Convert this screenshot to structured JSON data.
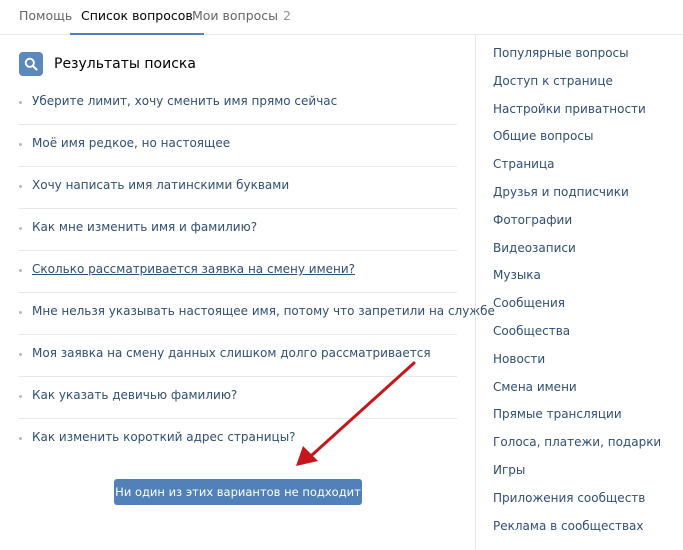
{
  "tabs": [
    {
      "label": "Помощь"
    },
    {
      "label": "Список вопросов"
    },
    {
      "label": "Мои вопросы",
      "count": "2"
    }
  ],
  "main": {
    "title": "Результаты поиска",
    "search_icon": "search-icon",
    "questions": [
      "Уберите лимит, хочу сменить имя прямо сейчас",
      "Моё имя редкое, но настоящее",
      "Хочу написать имя латинскими буквами",
      "Как мне изменить имя и фамилию?",
      "Сколько рассматривается заявка на смену имени?",
      "Мне нельзя указывать настоящее имя, потому что запретили на службе",
      "Моя заявка на смену данных слишком долго рассматривается",
      "Как указать девичью фамилию?",
      "Как изменить короткий адрес страницы?"
    ],
    "no_match_button": "Ни один из этих вариантов не подходит"
  },
  "sidebar": {
    "items": [
      "Популярные вопросы",
      "Доступ к странице",
      "Настройки приватности",
      "Общие вопросы",
      "Страница",
      "Друзья и подписчики",
      "Фотографии",
      "Видеозаписи",
      "Музыка",
      "Сообщения",
      "Сообщества",
      "Новости",
      "Смена имени",
      "Прямые трансляции",
      "Голоса, платежи, подарки",
      "Игры",
      "Приложения сообществ",
      "Реклама в сообществах"
    ]
  },
  "colors": {
    "accent": "#5181b8",
    "link": "#2f4f73",
    "annotation_arrow": "#c7161b"
  }
}
